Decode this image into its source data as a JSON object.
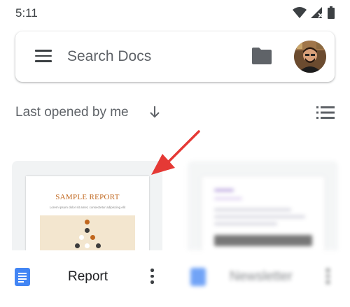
{
  "status_bar": {
    "time": "5:11",
    "icons": [
      "wifi-icon",
      "signal-icon",
      "battery-icon"
    ]
  },
  "search": {
    "placeholder": "Search Docs",
    "icons": [
      "menu-icon",
      "folder-icon",
      "avatar"
    ]
  },
  "sort": {
    "label": "Last opened by me",
    "direction_icon": "arrow-down-icon",
    "view_toggle_icon": "list-view-icon"
  },
  "documents": [
    {
      "name": "Report",
      "thumbnail_title": "SAMPLE REPORT",
      "thumbnail_subtitle": "Lorem ipsum dolor sit amet, consectetur adipiscing elit",
      "icon": "docs-icon"
    },
    {
      "name": "Newsletter",
      "icon": "docs-icon"
    }
  ],
  "colors": {
    "docs_blue": "#4285f4",
    "annotation_red": "#e53935",
    "report_accent": "#c0661d"
  }
}
